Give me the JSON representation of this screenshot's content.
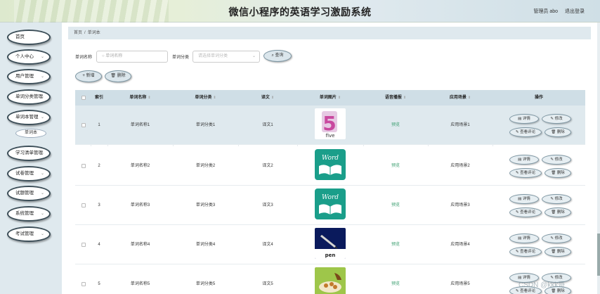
{
  "header": {
    "title": "微信小程序的英语学习激励系统",
    "user": "管理员 abo",
    "logout": "退出登录"
  },
  "sidebar": {
    "items": [
      {
        "label": "首页",
        "chevron": false
      },
      {
        "label": "个人中心",
        "chevron": true
      },
      {
        "label": "用户管理",
        "chevron": true
      },
      {
        "label": "单词分类管理",
        "chevron": true
      },
      {
        "label": "单词本管理",
        "chevron": true
      },
      {
        "label": "学习清单管理",
        "chevron": true
      },
      {
        "label": "试卷管理",
        "chevron": true
      },
      {
        "label": "试题管理",
        "chevron": true
      },
      {
        "label": "系统管理",
        "chevron": true
      },
      {
        "label": "考试管理",
        "chevron": true
      }
    ],
    "sub_item": "单词本"
  },
  "breadcrumb": {
    "home": "首页",
    "sep": "/",
    "current": "单词本"
  },
  "search": {
    "name_label": "单词名称",
    "name_placeholder": "单词名称",
    "cat_label": "单词分类",
    "cat_placeholder": "请选择单词分类",
    "query_button": "查询"
  },
  "toolbar": {
    "add_button": "+ 新增",
    "delete_button": "删除"
  },
  "table": {
    "headers": [
      "索引",
      "单词名称",
      "单词分类",
      "译文",
      "单词图片",
      "语音播报",
      "应用场景",
      "操作"
    ],
    "rows": [
      {
        "index": "1",
        "name": "单词名称1",
        "category": "单词分类1",
        "translation": "译文1",
        "audio": "预览",
        "scene": "应用场景1",
        "image": "five"
      },
      {
        "index": "2",
        "name": "单词名称2",
        "category": "单词分类2",
        "translation": "译文2",
        "audio": "预览",
        "scene": "应用场景2",
        "image": "word-book"
      },
      {
        "index": "3",
        "name": "单词名称3",
        "category": "单词分类3",
        "translation": "译文3",
        "audio": "预览",
        "scene": "应用场景3",
        "image": "word-book"
      },
      {
        "index": "4",
        "name": "单词名称4",
        "category": "单词分类4",
        "translation": "译文4",
        "audio": "预览",
        "scene": "应用场景4",
        "image": "pen"
      },
      {
        "index": "5",
        "name": "单词名称5",
        "category": "单词分类5",
        "translation": "译文5",
        "audio": "预览",
        "scene": "应用场景5",
        "image": "food"
      }
    ],
    "actions": {
      "detail": "详情",
      "edit": "修改",
      "comments": "查看评论",
      "delete": "删除"
    }
  },
  "image_text": {
    "five_digit": "5",
    "five_word": "five",
    "word_logo": "Word",
    "pen_word": "pen"
  },
  "watermark": "CSDN @kkk哥",
  "colors": {
    "accent": "#3c4e58",
    "header_bg": "#dfe9ee",
    "preview": "#3a9e6f",
    "word_logo": "#1a9e8a"
  }
}
